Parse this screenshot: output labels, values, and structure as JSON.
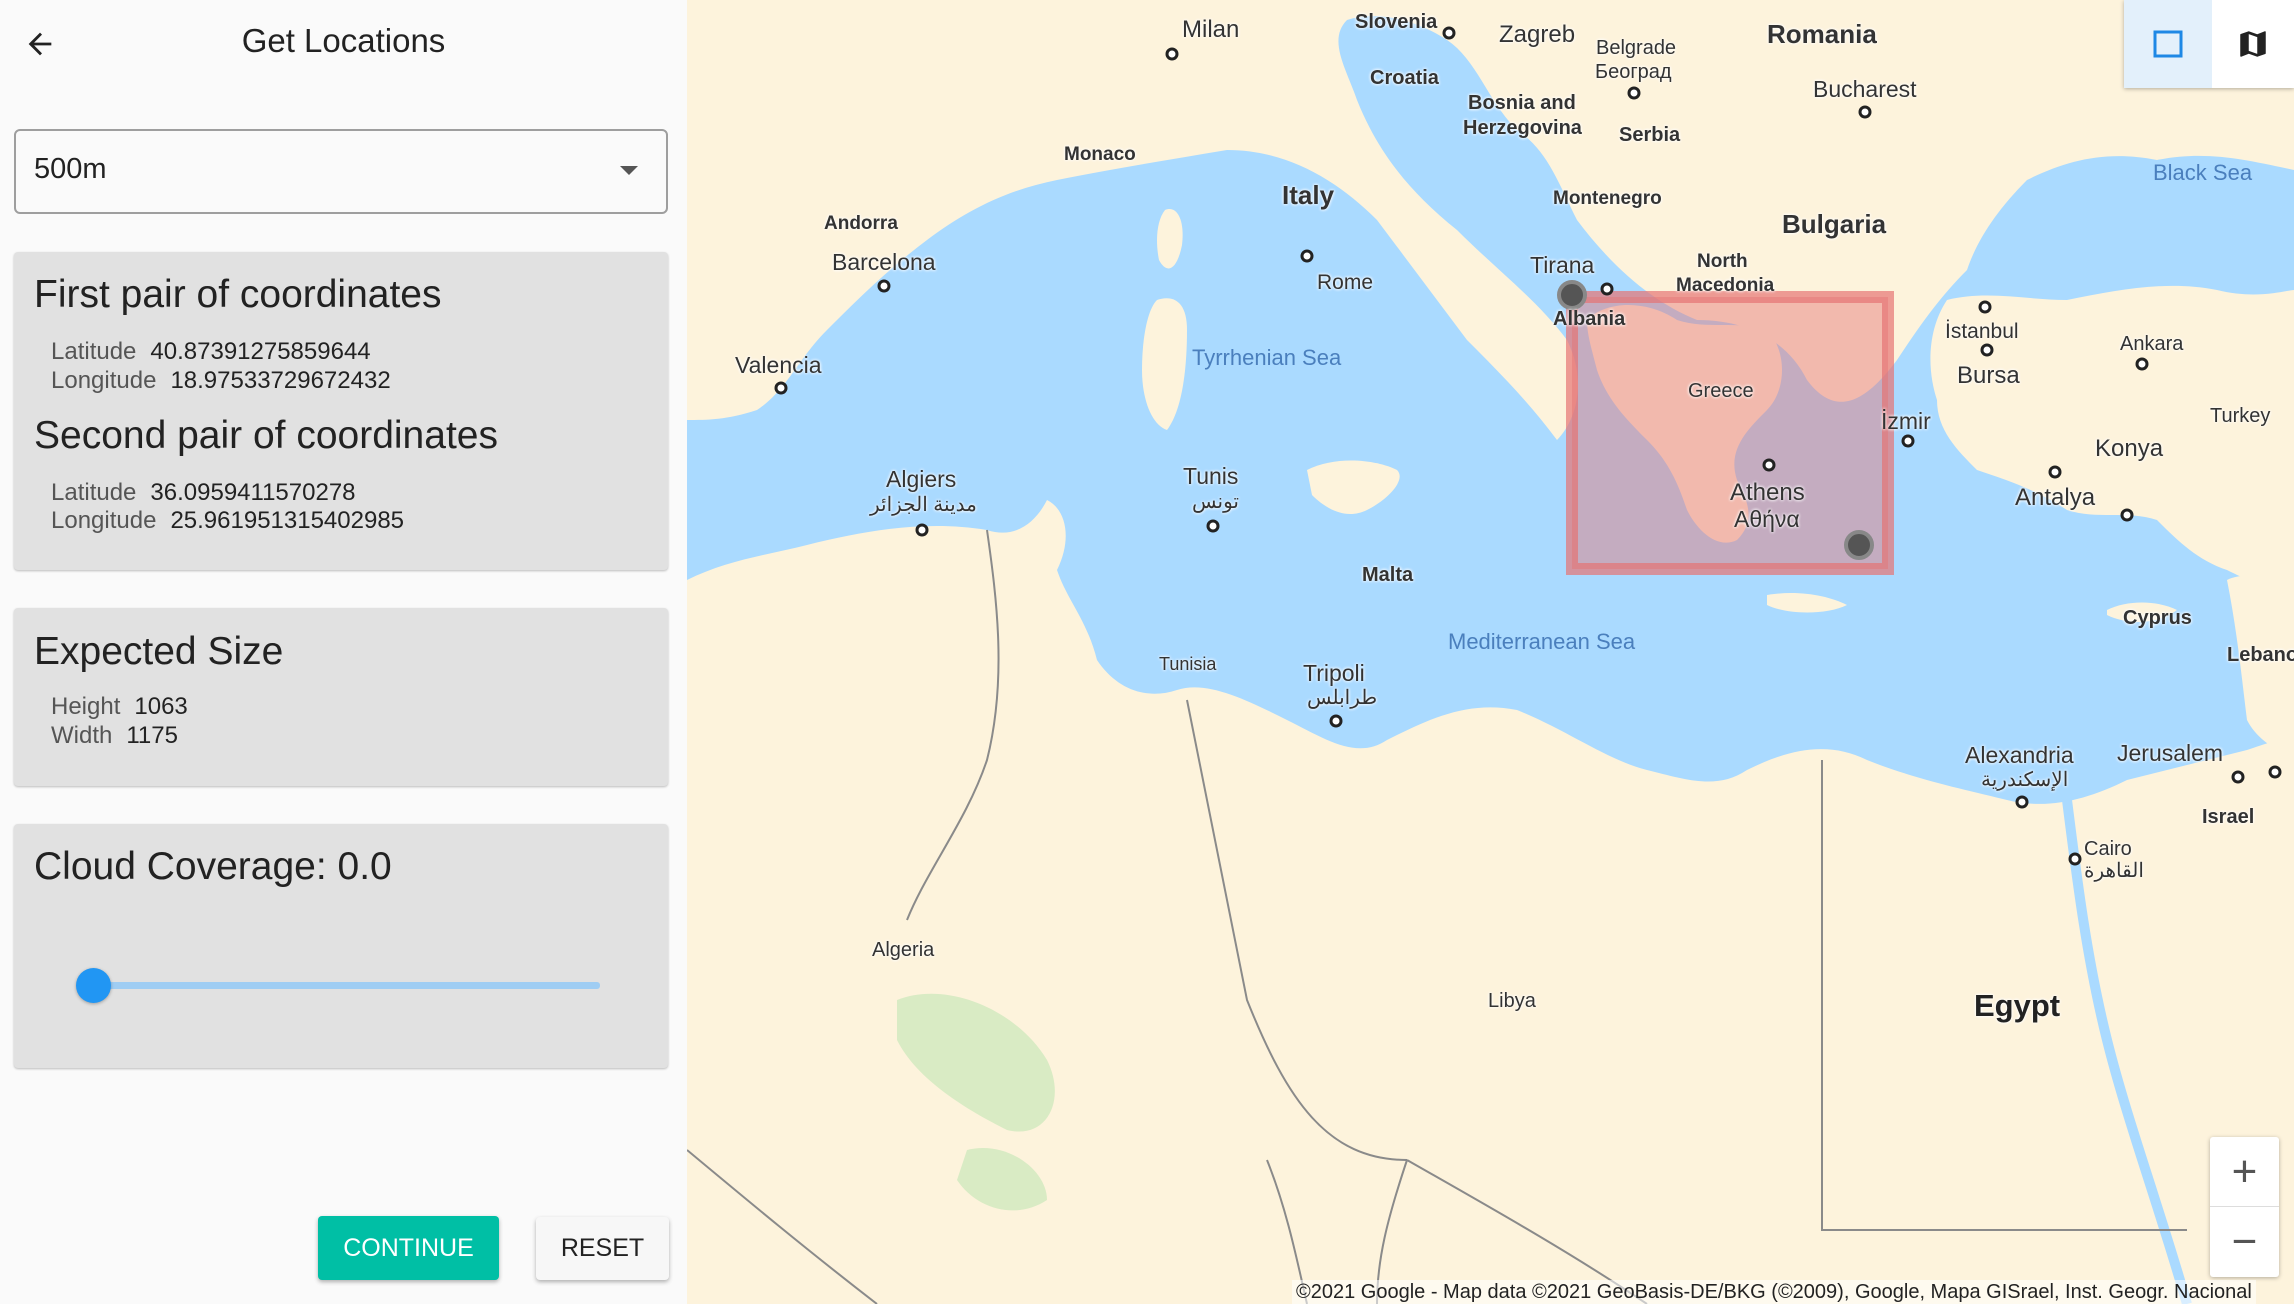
{
  "header": {
    "title": "Get Locations",
    "back_icon": "arrow-left-icon"
  },
  "resolution_select": {
    "value": "500m",
    "caret_icon": "caret-down-icon"
  },
  "coordinates_card": {
    "first_title": "First pair of coordinates",
    "first": {
      "lat_label": "Latitude",
      "lat_value": "40.87391275859644",
      "lon_label": "Longitude",
      "lon_value": "18.97533729672432"
    },
    "second_title": "Second pair of coordinates",
    "second": {
      "lat_label": "Latitude",
      "lat_value": "36.0959411570278",
      "lon_label": "Longitude",
      "lon_value": "25.961951315402985"
    }
  },
  "size_card": {
    "title": "Expected Size",
    "height_label": "Height",
    "height_value": "1063",
    "width_label": "Width",
    "width_value": "1175"
  },
  "cloud_card": {
    "title": "Cloud Coverage: 0.0",
    "slider_value": 0.0
  },
  "buttons": {
    "continue": "CONTINUE",
    "reset": "RESET"
  },
  "colors": {
    "accent": "#00bfa5",
    "slider": "#2196f3",
    "water": "#aadaff",
    "land": "#fdf3dc",
    "selection": "#e57373"
  },
  "map": {
    "labels": {
      "slovenia": "Slovenia",
      "zagreb": "Zagreb",
      "romania": "Romania",
      "milan": "Milan",
      "croatia": "Croatia",
      "belgrade": "Belgrade",
      "belgrade_cyr": "Београд",
      "bucharest": "Bucharest",
      "bosnia": "Bosnia and",
      "herzegovina": "Herzegovina",
      "serbia": "Serbia",
      "monaco": "Monaco",
      "black_sea": "Black Sea",
      "italy": "Italy",
      "montenegro": "Montenegro",
      "bulgaria": "Bulgaria",
      "andorra": "Andorra",
      "barcelona": "Barcelona",
      "rome": "Rome",
      "north": "North",
      "macedonia": "Macedonia",
      "tirana": "Tirana",
      "albania": "Albania",
      "istanbul": "İstanbul",
      "valencia": "Valencia",
      "tyrrhenian": "Tyrrhenian Sea",
      "greece": "Greece",
      "ankara": "Ankara",
      "bursa": "Bursa",
      "turkey": "Turkey",
      "izmir": "İzmir",
      "konya": "Konya",
      "algiers": "Algiers",
      "algiers_ar": "مدينة الجزائر",
      "tunis": "Tunis",
      "tunis_ar": "تونس",
      "athens": "Athens",
      "athens_gr": "Αθήνα",
      "antalya": "Antalya",
      "malta": "Malta",
      "cyprus": "Cyprus",
      "mediterranean": "Mediterranean Sea",
      "lebanon": "Lebano",
      "tunisia": "Tunisia",
      "tripoli": "Tripoli",
      "tripoli_ar": "طرابلس",
      "alexandria": "Alexandria",
      "alexandria_ar": "الإسكندرية",
      "jerusalem": "Jerusalem",
      "israel": "Israel",
      "cairo": "Cairo",
      "cairo_ar": "القاهرة",
      "algeria": "Algeria",
      "libya": "Libya",
      "egypt": "Egypt"
    },
    "tools": {
      "rectangle_icon": "rectangle-select-icon",
      "map_icon": "map-icon"
    },
    "zoom": {
      "in": "+",
      "out": "−"
    },
    "attribution": "©2021 Google - Map data ©2021 GeoBasis-DE/BKG (©2009), Google, Mapa GISrael, Inst. Geogr. Nacional"
  }
}
